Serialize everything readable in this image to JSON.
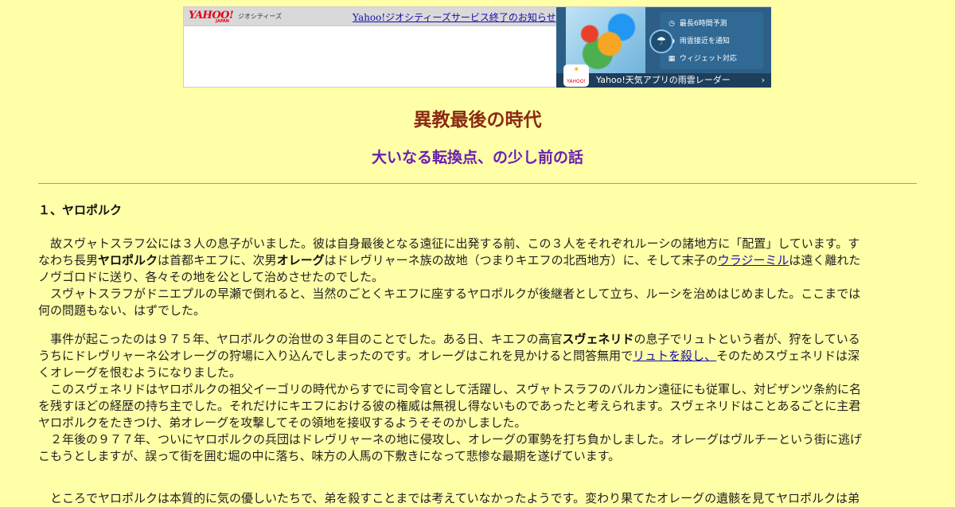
{
  "banner": {
    "logo": "YAHOO!",
    "logo_sub": "JAPAN",
    "service": "ジオシティーズ",
    "notice_link": "Yahoo!ジオシティーズサービス終了のお知らせ"
  },
  "ad": {
    "features": [
      "最長6時間予測",
      "雨雲接近を通知",
      "ウィジェット対応"
    ],
    "footer": "Yahoo!天気アプリの雨雲レーダー",
    "app_label": "YAHOO!"
  },
  "article": {
    "title": "異教最後の時代",
    "subtitle": "大いなる転換点、の少し前の話",
    "section": "１、ヤロポルク",
    "p1_l1": "　故スヴャトスラフ公には３人の息子がいました。彼は自身最後となる遠征に出発する前、この３人をそれぞれルーシの諸地方に「配置」しています。す",
    "p1_l2_a": "なわち長男",
    "p1_l2_b": "ヤロポルク",
    "p1_l2_c": "は首都キエフに、次男",
    "p1_l2_d": "オレーグ",
    "p1_l2_e": "はドレヴリャーネ族の故地（つまりキエフの北西地方）に、そして末子の",
    "p1_l2_link": "ウラジーミル",
    "p1_l2_f": "は遠く離れた",
    "p1_l3": "ノヴゴロドに送り、各々その地を公として治めさせたのでした。",
    "p1_l4": "　スヴャトスラフがドニエプルの早瀬で倒れると、当然のごとくキエフに座するヤロポルクが後継者として立ち、ルーシを治めはじめました。ここまでは",
    "p1_l5": "何の問題もない、はずでした。",
    "p2_l1_a": "　事件が起こったのは９７５年、ヤロポルクの治世の３年目のことでした。ある日、キエフの高官",
    "p2_l1_b": "スヴェネリド",
    "p2_l1_c": "の息子でリュトという者が、狩をしている",
    "p2_l2_a": "うちにドレヴリャーネ公オレーグの狩場に入り込んでしまったのです。オレーグはこれを見かけると問答無用で",
    "p2_l2_link": "リュトを殺し、",
    "p2_l2_b": "そのためスヴェネリドは深",
    "p2_l3": "くオレーグを恨むようになりました。",
    "p2_l4": "　このスヴェネリドはヤロポルクの祖父イーゴリの時代からすでに司令官として活躍し、スヴャトスラフのバルカン遠征にも従軍し、対ビザンツ条約に名",
    "p2_l5": "を残すほどの経歴の持ち主でした。それだけにキエフにおける彼の権威は無視し得ないものであったと考えられます。スヴェネリドはことあるごとに主君",
    "p2_l6": "ヤロポルクをたきつけ、弟オレーグを攻撃してその領地を接収するようそそのかしました。",
    "p2_l7": "　２年後の９７７年、ついにヤロポルクの兵団はドレヴリャーネの地に侵攻し、オレーグの軍勢を打ち負かしました。オレーグはヴルチーという街に逃げ",
    "p2_l8": "こもうとしますが、誤って街を囲む堀の中に落ち、味方の人馬の下敷きになって悲惨な最期を遂げています。",
    "p3_l1": "　ところでヤロポルクは本質的に気の優しいたちで、弟を殺すことまでは考えていなかったようです。変わり果てたオレーグの遺骸を見てヤロポルクは弟"
  },
  "colors": {
    "background": "#ffffa8",
    "title": "#8b2a12",
    "subtitle": "#6a1fb0",
    "link": "#1a0dab"
  }
}
